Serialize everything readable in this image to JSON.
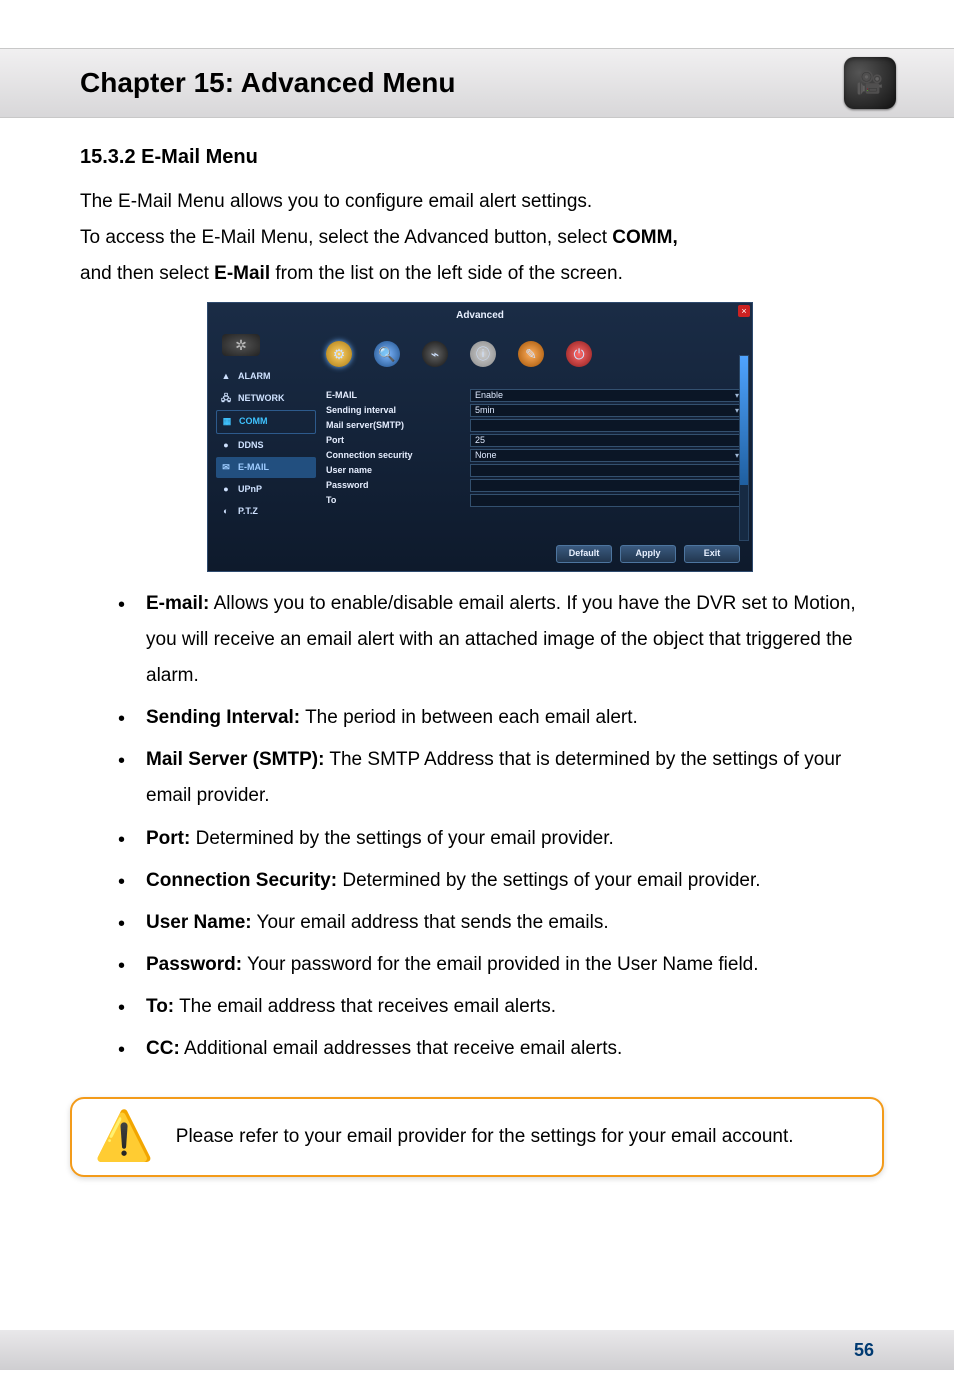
{
  "chapter_title": "Chapter 15: Advanced Menu",
  "section_heading": "15.3.2 E-Mail Menu",
  "intro_line": "The E-Mail Menu allows you to configure email alert settings.",
  "access_line_1a": "To access the E-Mail Menu, select the Advanced button, select ",
  "access_line_1b": "COMM,",
  "access_line_2a": "and then select ",
  "access_line_2b": "E-Mail",
  "access_line_2c": " from the list on the left side of the screen.",
  "bullets": [
    {
      "term": "E-mail:",
      "desc": " Allows you to enable/disable email alerts. If you have the DVR set to Motion, you will receive an email alert with an attached image of the object that triggered the alarm."
    },
    {
      "term": "Sending Interval:",
      "desc": " The period in between each email alert."
    },
    {
      "term": "Mail Server (SMTP):",
      "desc": " The SMTP Address that is determined by the settings of your email provider."
    },
    {
      "term": "Port:",
      "desc": " Determined by the settings of your email provider."
    },
    {
      "term": "Connection Security:",
      "desc": " Determined by the settings of your email provider."
    },
    {
      "term": "User Name:",
      "desc": " Your email address that sends the emails."
    },
    {
      "term": "Password:",
      "desc": " Your password for the email provided in the User Name field."
    },
    {
      "term": "To:",
      "desc": " The email address that receives email alerts."
    },
    {
      "term": "CC:",
      "desc": " Additional email addresses that receive email alerts."
    }
  ],
  "note_text": "Please refer to your email provider for the settings for your email account.",
  "page_number": "56",
  "dvr": {
    "window_title": "Advanced",
    "sidebar": [
      {
        "icon": "▲",
        "label": "ALARM"
      },
      {
        "icon": "🖧",
        "label": "NETWORK"
      },
      {
        "icon": "▦",
        "label": "COMM"
      },
      {
        "icon": "●",
        "label": "DDNS"
      },
      {
        "icon": "✉",
        "label": "E-MAIL"
      },
      {
        "icon": "●",
        "label": "UPnP"
      },
      {
        "icon": "◐",
        "label": "P.T.Z"
      }
    ],
    "form": {
      "email_label": "E-MAIL",
      "email_value": "Enable",
      "interval_label": "Sending interval",
      "interval_value": "5min",
      "smtp_label": "Mail server(SMTP)",
      "smtp_value": "",
      "port_label": "Port",
      "port_value": "25",
      "connsec_label": "Connection security",
      "connsec_value": "None",
      "username_label": "User name",
      "username_value": "",
      "password_label": "Password",
      "password_value": "",
      "to_label": "To",
      "to_value": ""
    },
    "buttons": {
      "default": "Default",
      "apply": "Apply",
      "exit": "Exit"
    }
  }
}
